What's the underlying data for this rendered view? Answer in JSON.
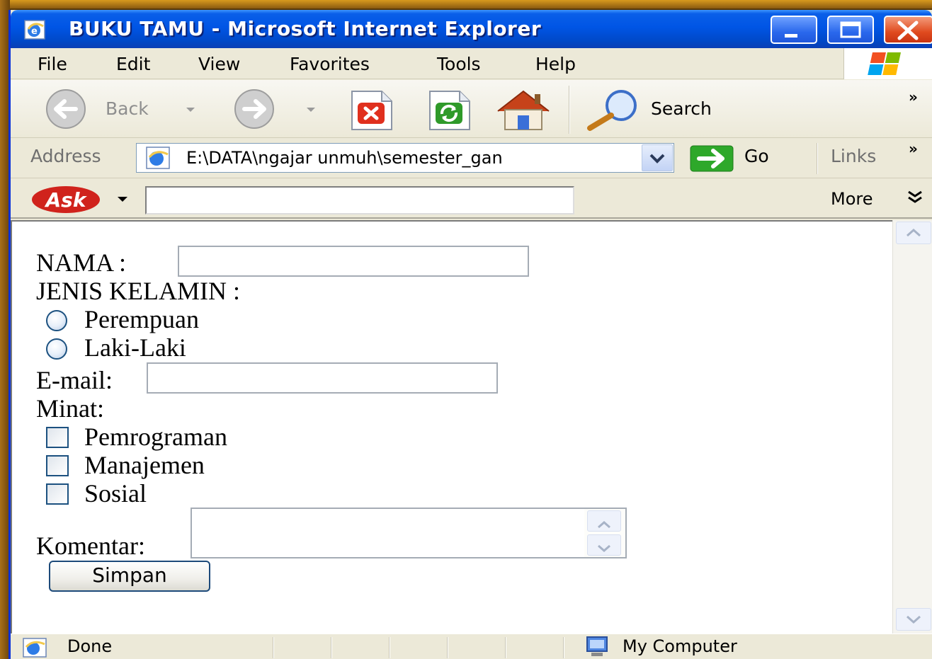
{
  "window": {
    "title": "BUKU TAMU - Microsoft Internet Explorer"
  },
  "menu": [
    "File",
    "Edit",
    "View",
    "Favorites",
    "Tools",
    "Help"
  ],
  "toolbar": {
    "back_label": "Back",
    "search_label": "Search",
    "overflow_label": "»"
  },
  "address_bar": {
    "label": "Address",
    "value": "E:\\DATA\\ngajar unmuh\\semester_gan",
    "go_label": "Go",
    "links_label": "Links",
    "overflow_label": "»"
  },
  "ask_bar": {
    "logo_text": "Ask",
    "search_value": "",
    "more_label": "More"
  },
  "form": {
    "nama_label": "NAMA :",
    "gender_label": "JENIS KELAMIN :",
    "gender_options": [
      "Perempuan",
      "Laki-Laki"
    ],
    "email_label": "E-mail:",
    "minat_label": "Minat:",
    "minat_options": [
      "Pemrograman",
      "Manajemen",
      "Sosial"
    ],
    "komentar_label": "Komentar:",
    "submit_label": "Simpan"
  },
  "status_bar": {
    "status": "Done",
    "zone": "My Computer"
  }
}
